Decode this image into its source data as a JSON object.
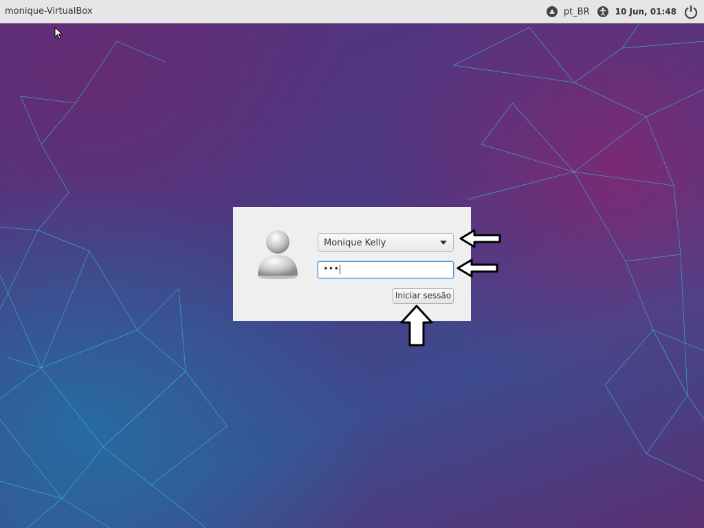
{
  "topbar": {
    "hostname": "monique-VirtualBox",
    "language": "pt_BR",
    "clock": "10 Jun, 01:48",
    "icons": [
      "keyboard-layout-icon",
      "accessibility-icon",
      "power-icon"
    ]
  },
  "login": {
    "user_name": "Monique Kelly",
    "password_value": "•••",
    "signin_label": "Iniciar sessão",
    "icons": [
      "user-avatar-icon",
      "chevron-down-icon"
    ]
  },
  "annotations": {
    "icons": [
      "arrow-left-icon",
      "arrow-left-icon",
      "arrow-up-icon"
    ]
  },
  "colors": {
    "topbar_bg": "#e6e6e6",
    "panel_bg": "#efefef",
    "focus_border": "#4a90d9",
    "mesh_line": "#35c4dc"
  }
}
